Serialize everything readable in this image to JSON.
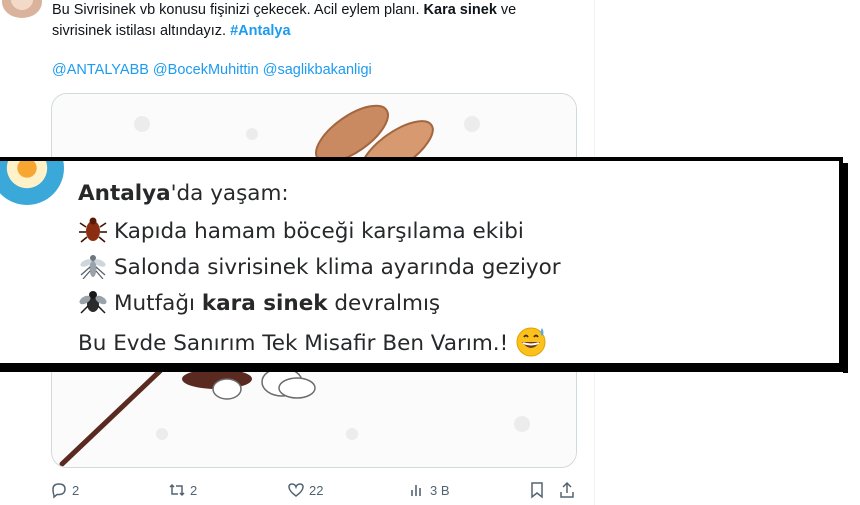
{
  "tweet": {
    "line1_plain": "Bu Sivrisinek vb konusu fişinizi çekecek. Acil eylem planı. ",
    "line1_bold": "Kara sinek",
    "line1_tail": " ve",
    "line2_plain": "sivrisinek istilası altındayız. ",
    "hashtag": "#Antalya",
    "mentions": [
      "@ANTALYABB",
      "@BocekMuhittin",
      "@saglikbakanligi"
    ]
  },
  "overlay": {
    "line1_bold": "Antalya",
    "line1_rest": "'da yaşam:",
    "line2": "Kapıda hamam böceği karşılama ekibi",
    "line3": "Salonda sivrisinek klima ayarında geziyor",
    "line4_pre": "Mutfağı ",
    "line4_bold": "kara sinek",
    "line4_post": " devralmış",
    "line5": "Bu Evde Sanırım Tek Misafir Ben Varım.!",
    "icons": [
      "cockroach-icon",
      "mosquito-icon",
      "fly-icon",
      "grinning-sweat-emoji"
    ]
  },
  "actions": {
    "reply_count": "2",
    "retweet_count": "2",
    "like_count": "22",
    "view_count": "3 B"
  },
  "colors": {
    "link": "#1d9bf0",
    "muted": "#536471",
    "border": "#cfd9de"
  }
}
